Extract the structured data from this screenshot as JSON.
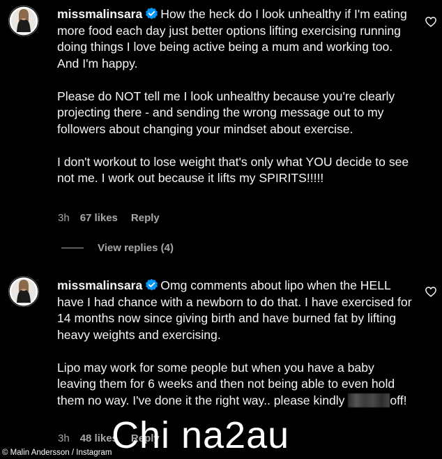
{
  "comments": [
    {
      "username": "missmalinsara",
      "text": "How the heck do I look unhealthy if I'm eating more food each day just better options lifting exercising running doing things I love being active being a mum and working too. And I'm happy.\n\nPlease do NOT tell me I look unhealthy because you're clearly projecting there - and sending the wrong message out to my followers about changing your mindset about exercise.\n\nI don't workout to lose weight that's only what YOU decide to see not me. I work out because it lifts my SPIRITS!!!!!",
      "time": "3h",
      "likes": "67 likes",
      "reply": "Reply",
      "view_replies": "View replies (4)"
    },
    {
      "username": "missmalinsara",
      "text_main": "Omg comments about lipo when the HELL have I had chance with a newborn to do that. I have exercised for 14 months now since giving birth and have burned fat by lifting heavy weights and exercising.\n\nLipo may work for some people but when you have a baby leaving them for 6 weeks and then not being able to even hold them no way. I've done it the right way.. please kindly ",
      "text_end": "off!",
      "time": "3h",
      "likes": "48 likes",
      "reply": "Reply"
    }
  ],
  "credit": "© Malin Andersson / Instagram",
  "watermark": "Chi na2au",
  "icons": {
    "verified": "verified-badge-icon",
    "heart": "heart-outline-icon"
  },
  "colors": {
    "background": "#000000",
    "text": "#f5f5f5",
    "meta": "#a8a8a8",
    "verified": "#0095f6"
  }
}
